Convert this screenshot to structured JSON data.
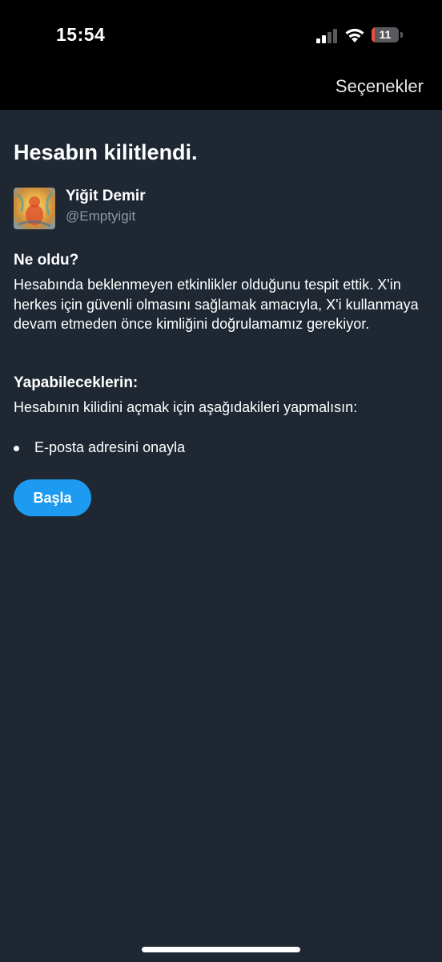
{
  "status_bar": {
    "time": "15:54",
    "battery_level": "11",
    "battery_fraction": 0.11,
    "icons": [
      "cellular-signal-icon",
      "wifi-icon",
      "battery-icon"
    ]
  },
  "header": {
    "options_label": "Seçenekler"
  },
  "page": {
    "title": "Hesabın kilitlendi."
  },
  "user": {
    "name": "Yiğit Demir",
    "handle": "@Emptyigit"
  },
  "what_happened": {
    "heading": "Ne oldu?",
    "text": "Hesabında beklenmeyen etkinlikler olduğunu tespit ettik. X'in herkes için güvenli olmasını sağlamak amacıyla, X'i kullanmaya devam etmeden önce kimliğini doğrulamamız gerekiyor."
  },
  "what_you_can_do": {
    "heading": "Yapabileceklerin:",
    "text": "Hesabının kilidini açmak için aşağıdakileri yapmalısın:",
    "items": [
      "E-posta adresini onayla"
    ]
  },
  "actions": {
    "start_label": "Başla"
  },
  "colors": {
    "background": "#1e2732",
    "top_bar": "#000000",
    "accent": "#1d9bf0",
    "secondary_text": "#8b98a5",
    "battery_low": "#eb4d3d"
  }
}
